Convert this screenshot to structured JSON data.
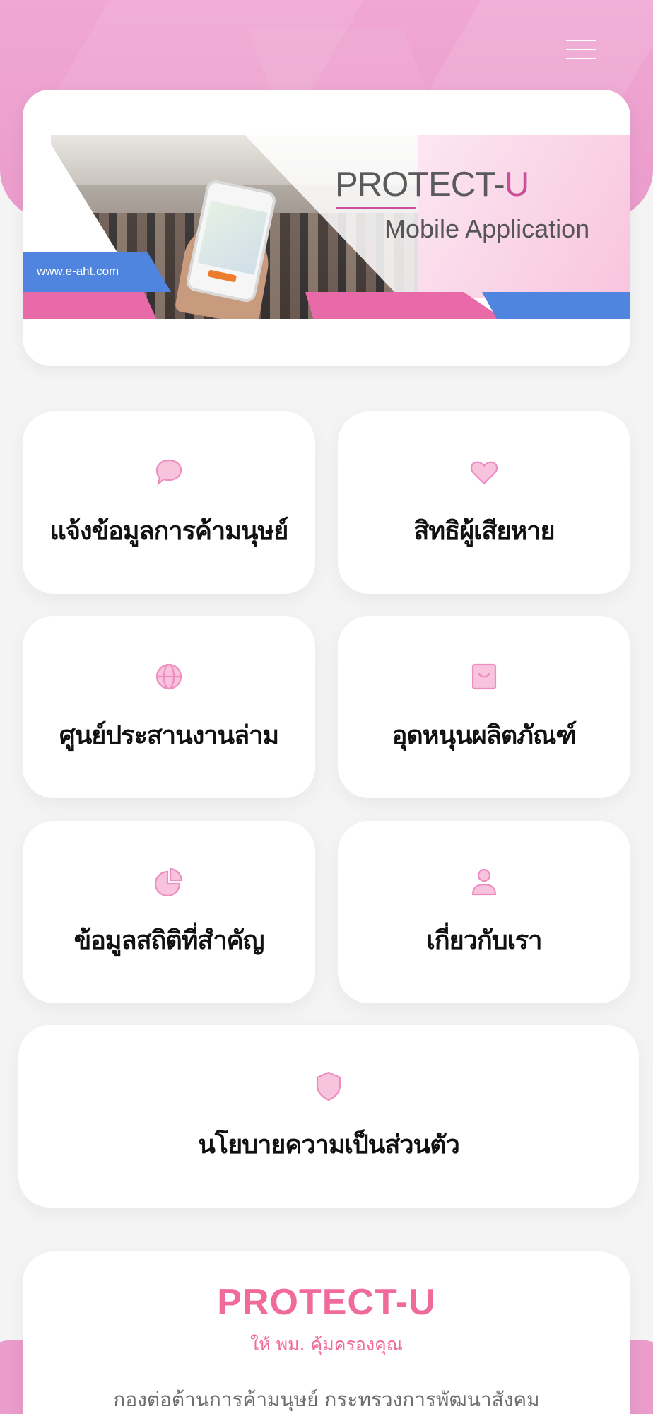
{
  "header": {
    "menu_icon": "hamburger-menu-icon"
  },
  "banner": {
    "title_main": "PROTECT-",
    "title_accent": "U",
    "subtitle": "Mobile Application",
    "url": "www.e-aht.com"
  },
  "menu": {
    "items": [
      {
        "label": "แจ้งข้อมูลการค้ามนุษย์",
        "icon": "chat-bubble-icon"
      },
      {
        "label": "สิทธิผู้เสียหาย",
        "icon": "heart-icon"
      },
      {
        "label": "ศูนย์ประสานงานล่าม",
        "icon": "globe-icon"
      },
      {
        "label": "อุดหนุนผลิตภัณฑ์",
        "icon": "shopping-bag-icon"
      },
      {
        "label": "ข้อมูลสถิติที่สำคัญ",
        "icon": "pie-chart-icon"
      },
      {
        "label": "เกี่ยวกับเรา",
        "icon": "user-icon"
      },
      {
        "label": "นโยบายความเป็นส่วนตัว",
        "icon": "shield-icon"
      }
    ]
  },
  "footer": {
    "title": "PROTECT-U",
    "tagline": "ให้ พม. คุ้มครองคุณ",
    "organization": "กองต่อต้านการค้ามนุษย์ กระทรวงการพัฒนาสังคม"
  },
  "colors": {
    "accent_pink": "#f06b9b",
    "header_pink": "#ea9ccb",
    "icon_pink": "#f2a6cf",
    "banner_blue": "#4f85df"
  }
}
